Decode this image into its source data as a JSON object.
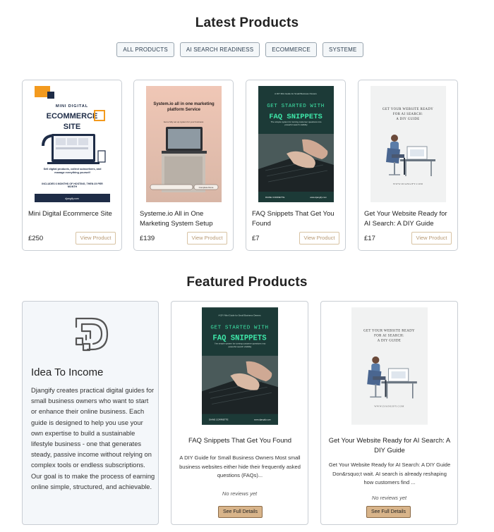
{
  "latest": {
    "title": "Latest Products",
    "filters": [
      "ALL PRODUCTS",
      "AI SEARCH READINESS",
      "ECOMMERCE",
      "SYSTEME"
    ],
    "view_label": "View Product",
    "products": [
      {
        "name": "Mini Digital Ecommerce Site",
        "price": "£250",
        "cover": {
          "line1": "MINI DIGITAL",
          "line2": "ECOMMERCE",
          "line3": "SITE",
          "tagline": "Sell digital products, collect subscribers, and manage everything yourself",
          "offer": "INCLUDES 6 MONTHS OF HOSTING, THEN £9 PER MONTH",
          "footer": "djangify.com"
        }
      },
      {
        "name": "Systeme.io All in One Marketing System Setup",
        "price": "£139",
        "cover": {
          "line1": "System.io all in one marketing platform Service",
          "line2": "Get a fully set up system for your business",
          "footer": "Complete Done"
        }
      },
      {
        "name": "FAQ Snippets That Get You Found",
        "price": "£7",
        "cover": {
          "kicker": "A DIY Mini Guide for Small Business Owners",
          "line1": "GET STARTED WITH",
          "line2": "FAQ SNIPPETS",
          "tagline": "The simple system for turning customer questions into powerful search visibility",
          "author": "DIANE CORRIETTE",
          "site": "www.djangify.com"
        }
      },
      {
        "name": "Get Your Website Ready for AI Search: A DIY Guide",
        "price": "£17",
        "cover": {
          "line1": "GET YOUR WEBSITE READY",
          "line2": "FOR AI SEARCH:",
          "line3": "A DIY GUIDE",
          "footer": "WWW.DJANGIFY.COM"
        }
      }
    ]
  },
  "featured": {
    "title": "Featured Products",
    "intro": {
      "heading": "Idea To Income",
      "body": "Djangify creates practical digital guides for small business owners who want to start or enhance their online business. Each guide is designed to help you use your own expertise to build a sustainable lifestyle business - one that generates steady, passive income without relying on complex tools or endless subscriptions. Our goal is to make the process of earning online simple, structured, and achievable."
    },
    "products": [
      {
        "title": "FAQ Snippets That Get You Found",
        "desc": "A DIY Guide for Small Business Owners Most small business websites either hide their frequently asked questions (FAQs)...",
        "reviews": "No reviews yet",
        "button": "See Full Details",
        "cover": {
          "kicker": "A DIY Mini Guide for Small Business Owners",
          "line1": "GET STARTED WITH",
          "line2": "FAQ SNIPPETS",
          "tagline": "The simple system for turning customer questions into powerful search visibility",
          "author": "DIANE CORRIETTE",
          "site": "www.djangify.com"
        }
      },
      {
        "title": "Get Your Website Ready for AI Search: A DIY Guide",
        "desc": "Get Your Website Ready for AI Search: A DIY Guide Don&rsquo;t wait. AI search is already reshaping how customers find ...",
        "reviews": "No reviews yet",
        "button": "See Full Details",
        "cover": {
          "line1": "GET YOUR WEBSITE READY",
          "line2": "FOR AI SEARCH:",
          "line3": "A DIY GUIDE",
          "footer": "WWW.DJANGIFY.COM"
        }
      }
    ]
  },
  "colors": {
    "accent": "#d8b48a",
    "faq_dark": "#1c3a37",
    "faq_green": "#3ee6a8",
    "ecom_orange": "#f39a1e",
    "ecom_navy": "#1e2c47"
  }
}
